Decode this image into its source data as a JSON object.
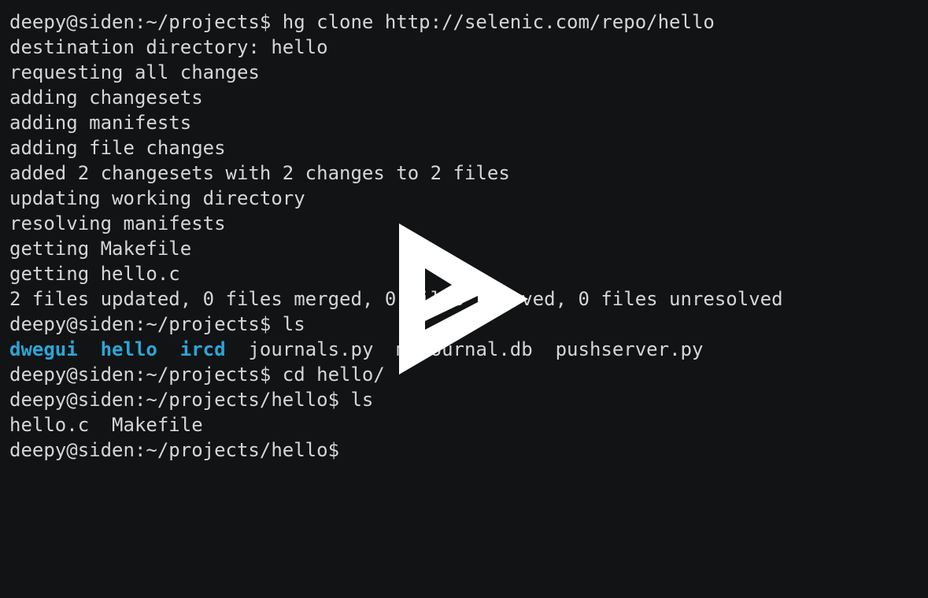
{
  "terminal": {
    "lines": [
      "deepy@siden:~/projects$ hg clone http://selenic.com/repo/hello",
      "destination directory: hello",
      "requesting all changes",
      "adding changesets",
      "adding manifests",
      "adding file changes",
      "added 2 changesets with 2 changes to 2 files",
      "updating working directory",
      "resolving manifests",
      "getting Makefile",
      "getting hello.c",
      "2 files updated, 0 files merged, 0 files removed, 0 files unresolved",
      "deepy@siden:~/projects$ ls"
    ],
    "ls_output": {
      "dir1": "dwegui",
      "sep1": "  ",
      "dir2": "hello",
      "sep2": "  ",
      "dir3": "ircd",
      "files": "  journals.py  myjournal.db  pushserver.py"
    },
    "lines_after": [
      "deepy@siden:~/projects$ cd hello/",
      "deepy@siden:~/projects/hello$ ls",
      "hello.c  Makefile",
      "deepy@siden:~/projects/hello$"
    ],
    "colors": {
      "background": "#121315",
      "text": "#d6d6d6",
      "directory": "#2aa7d8",
      "overlay": "#ffffff"
    }
  },
  "overlay": {
    "icon": "asciinema-play-icon"
  }
}
